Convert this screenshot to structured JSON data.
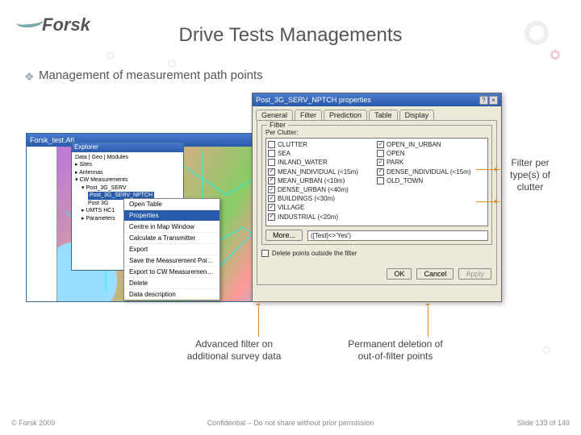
{
  "logo": "Forsk",
  "title": "Drive Tests Managements",
  "subtitle": "Management of measurement path points",
  "gis": {
    "title": "Forsk_test.Atl",
    "explorer": {
      "title": "Explorer",
      "tabs": [
        "Data",
        "Geo",
        "Modules"
      ],
      "nodes": [
        "Sites",
        "Antennas",
        "CW Measurements",
        "Post_3G_SERV",
        "Post_3G_SERV_NPTCH",
        "Post 3G",
        "UMTS HC1",
        "Parameters"
      ]
    },
    "context_menu": [
      "Open Table",
      "Properties",
      "Centre in Map Window",
      "Calculate a Transmitter",
      "Export",
      "Save the Measurement Points...",
      "Export to CW Measurements...",
      "Delete",
      "Data description"
    ]
  },
  "props": {
    "title": "Post_3G_SERV_NPTCH properties",
    "tabs": [
      "General",
      "Filter",
      "Prediction",
      "Table",
      "Display"
    ],
    "filter": {
      "group_label": "Filter",
      "per_clutter_label": "Per Clutter:",
      "clutter": [
        "CLUTTER",
        "SEA",
        "INLAND_WATER",
        "MEAN_INDIVIDUAL (<15m)",
        "MEAN_URBAN (<10m)",
        "DENSE_URBAN (<40m)",
        "BUILDINGS (<30m)",
        "VILLAGE",
        "INDUSTRIAL (<20m)",
        "OPEN_IN_URBAN",
        "OPEN",
        "PARK",
        "DENSE_INDIVIDUAL (<15m)",
        "OLD_TOWN"
      ],
      "more_btn": "More...",
      "expression": "([Test]<>'Yes')",
      "delete_label": "Delete points outside the filter"
    },
    "buttons": {
      "ok": "OK",
      "cancel": "Cancel",
      "apply": "Apply"
    }
  },
  "callouts": {
    "filter_clutter": "Filter per type(s) of clutter",
    "advanced_filter": "Advanced filter on additional survey data",
    "permanent_deletion": "Permanent deletion of out-of-filter points"
  },
  "footer": {
    "copyright": "© Forsk 2009",
    "confidential": "Confidential – Do not share without prior permission",
    "page": "Slide 133 of 149"
  }
}
